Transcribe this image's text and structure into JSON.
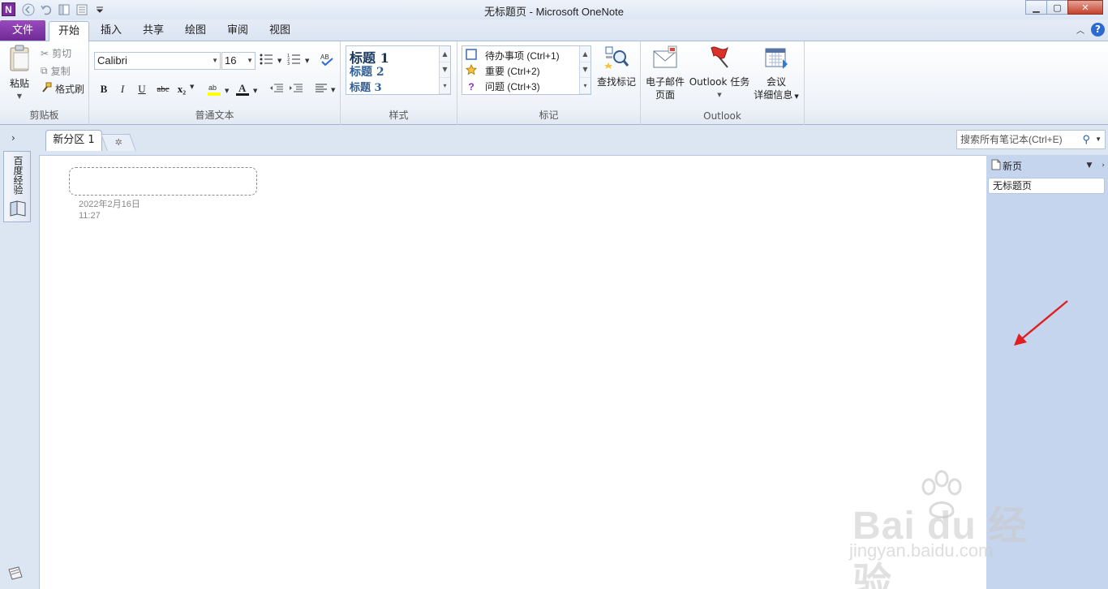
{
  "window": {
    "title": "无标题页 - Microsoft OneNote",
    "logo": "N",
    "minimize": "▁",
    "maximize": "▢",
    "close": "✕"
  },
  "ribbon_tabs": {
    "file": "文件",
    "items": [
      "开始",
      "插入",
      "共享",
      "绘图",
      "审阅",
      "视图"
    ]
  },
  "clipboard": {
    "paste": "粘贴",
    "cut": "剪切",
    "copy": "复制",
    "format_painter": "格式刷",
    "label": "剪贴板"
  },
  "basic_text": {
    "font": "Calibri",
    "size": "16",
    "bold": "B",
    "italic": "I",
    "underline": "U",
    "strike": "abc",
    "subscript": "x₂",
    "label": "普通文本"
  },
  "styles": {
    "h1": "标题 1",
    "h2": "标题 2",
    "h3": "标题 3",
    "label": "样式"
  },
  "tags": {
    "todo": "待办事项 (Ctrl+1)",
    "important": "重要 (Ctrl+2)",
    "question": "问题 (Ctrl+3)",
    "find_tags": "查找标记",
    "label": "标记"
  },
  "outlook": {
    "email_line1": "电子邮件",
    "email_line2": "页面",
    "tasks": "Outlook 任务",
    "meeting_line1": "会议",
    "meeting_line2": "详细信息",
    "label": "Outlook"
  },
  "notebook": {
    "name": "百度经验",
    "section": "新分区 1",
    "search_placeholder": "搜索所有笔记本(Ctrl+E)"
  },
  "page": {
    "date": "2022年2月16日",
    "time": "11:27"
  },
  "pages_pane": {
    "new_page": "新页",
    "items": [
      "无标题页"
    ]
  },
  "watermark": {
    "brand": "Bai du 经验",
    "url": "jingyan.baidu.com"
  },
  "colors": {
    "file_tab": "#7b2f9e",
    "pages_pane": "#c6d5ee",
    "annotation_arrow": "#e02020"
  }
}
